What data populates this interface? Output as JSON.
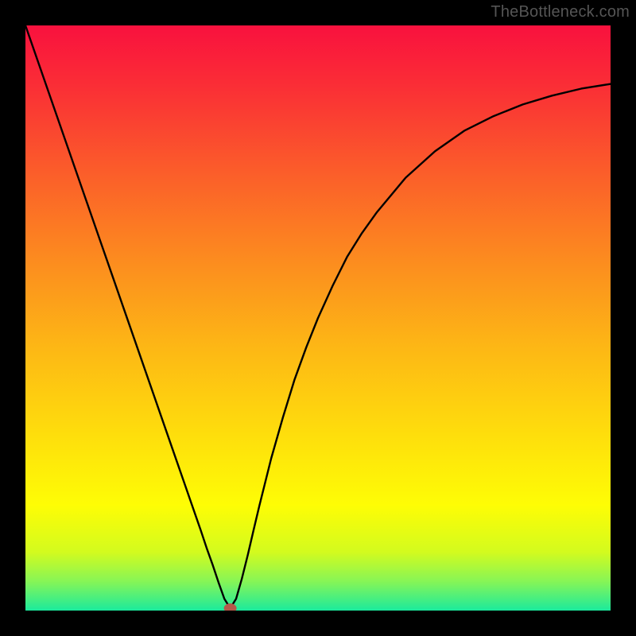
{
  "watermark": "TheBottleneck.com",
  "chart_data": {
    "type": "line",
    "title": "",
    "xlabel": "",
    "ylabel": "",
    "xlim": [
      0,
      1
    ],
    "ylim": [
      0,
      1
    ],
    "grid": false,
    "legend": false,
    "series": [
      {
        "name": "curve",
        "x": [
          0.0,
          0.025,
          0.05,
          0.075,
          0.1,
          0.125,
          0.15,
          0.175,
          0.2,
          0.225,
          0.25,
          0.275,
          0.3,
          0.31,
          0.32,
          0.33,
          0.34,
          0.35,
          0.36,
          0.37,
          0.38,
          0.39,
          0.4,
          0.42,
          0.44,
          0.46,
          0.48,
          0.5,
          0.525,
          0.55,
          0.575,
          0.6,
          0.65,
          0.7,
          0.75,
          0.8,
          0.85,
          0.9,
          0.95,
          1.0
        ],
        "y": [
          1.0,
          0.928,
          0.856,
          0.784,
          0.712,
          0.64,
          0.568,
          0.496,
          0.424,
          0.352,
          0.28,
          0.208,
          0.136,
          0.106,
          0.078,
          0.048,
          0.02,
          0.004,
          0.02,
          0.055,
          0.095,
          0.138,
          0.18,
          0.26,
          0.33,
          0.395,
          0.45,
          0.5,
          0.555,
          0.605,
          0.645,
          0.68,
          0.74,
          0.785,
          0.82,
          0.845,
          0.865,
          0.88,
          0.892,
          0.9
        ]
      }
    ],
    "marker": {
      "x": 0.35,
      "y": 0.004,
      "color": "#b55a4a"
    },
    "background_gradient": {
      "stops": [
        {
          "offset": 0.0,
          "color": "#f9113e"
        },
        {
          "offset": 0.1,
          "color": "#fa2d36"
        },
        {
          "offset": 0.25,
          "color": "#fb5d2a"
        },
        {
          "offset": 0.4,
          "color": "#fc8b1f"
        },
        {
          "offset": 0.55,
          "color": "#fdb715"
        },
        {
          "offset": 0.7,
          "color": "#fede0c"
        },
        {
          "offset": 0.82,
          "color": "#fefd05"
        },
        {
          "offset": 0.9,
          "color": "#d3fb1e"
        },
        {
          "offset": 0.95,
          "color": "#87f556"
        },
        {
          "offset": 1.0,
          "color": "#1bea9d"
        }
      ]
    }
  }
}
